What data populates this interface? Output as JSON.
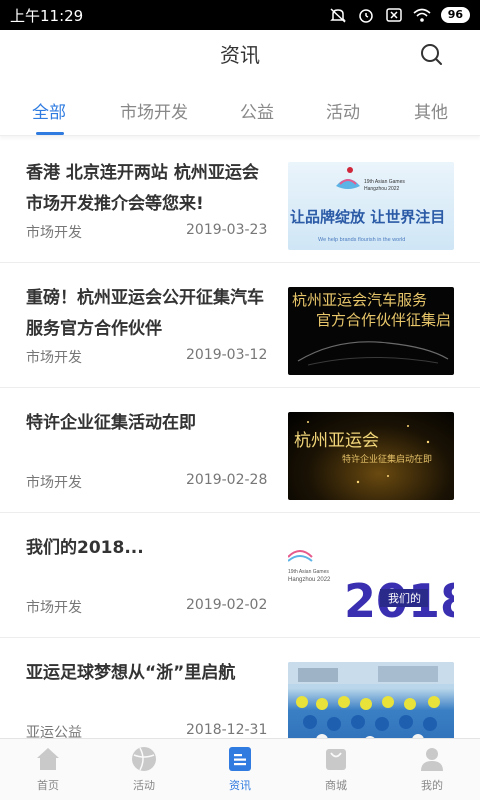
{
  "status_bar": {
    "time": "上午11:29",
    "battery": "96"
  },
  "header": {
    "title": "资讯"
  },
  "tabs": [
    {
      "label": "全部",
      "active": true
    },
    {
      "label": "市场开发",
      "active": false
    },
    {
      "label": "公益",
      "active": false
    },
    {
      "label": "活动",
      "active": false
    },
    {
      "label": "其他",
      "active": false
    }
  ],
  "articles": [
    {
      "title": "香港 北京连开两站 杭州亚运会市场开发推介会等您来!",
      "category": "市场开发",
      "date": "2019-03-23",
      "thumb_texts": [
        "19th Asian Games",
        "Hangzhou 2022",
        "让品牌绽放  让世界注目",
        "We help brands flourish in the world"
      ]
    },
    {
      "title": "重磅！杭州亚运会公开征集汽车服务官方合作伙伴",
      "category": "市场开发",
      "date": "2019-03-12",
      "thumb_texts": [
        "杭州亚运会汽车服务",
        "官方合作伙伴征集启"
      ]
    },
    {
      "title": "特许企业征集活动在即",
      "category": "市场开发",
      "date": "2019-02-28",
      "thumb_texts": [
        "杭州亚运会",
        "特许企业征集启动在即"
      ]
    },
    {
      "title": "我们的2018...",
      "category": "市场开发",
      "date": "2019-02-02",
      "thumb_texts": [
        "19th Asian Games",
        "Hangzhou 2022",
        "2018",
        "我们的"
      ]
    },
    {
      "title": "亚运足球梦想从“浙”里启航",
      "category": "亚运公益",
      "date": "2018-12-31",
      "thumb_texts": []
    }
  ],
  "tabbar": [
    {
      "label": "首页",
      "icon": "home-icon",
      "active": false
    },
    {
      "label": "活动",
      "icon": "ball-icon",
      "active": false
    },
    {
      "label": "资讯",
      "icon": "news-icon",
      "active": true
    },
    {
      "label": "商城",
      "icon": "shop-bag-icon",
      "active": false
    },
    {
      "label": "我的",
      "icon": "user-icon",
      "active": false
    }
  ],
  "colors": {
    "accent": "#2f7be0",
    "text": "#333333",
    "muted": "#777777"
  }
}
